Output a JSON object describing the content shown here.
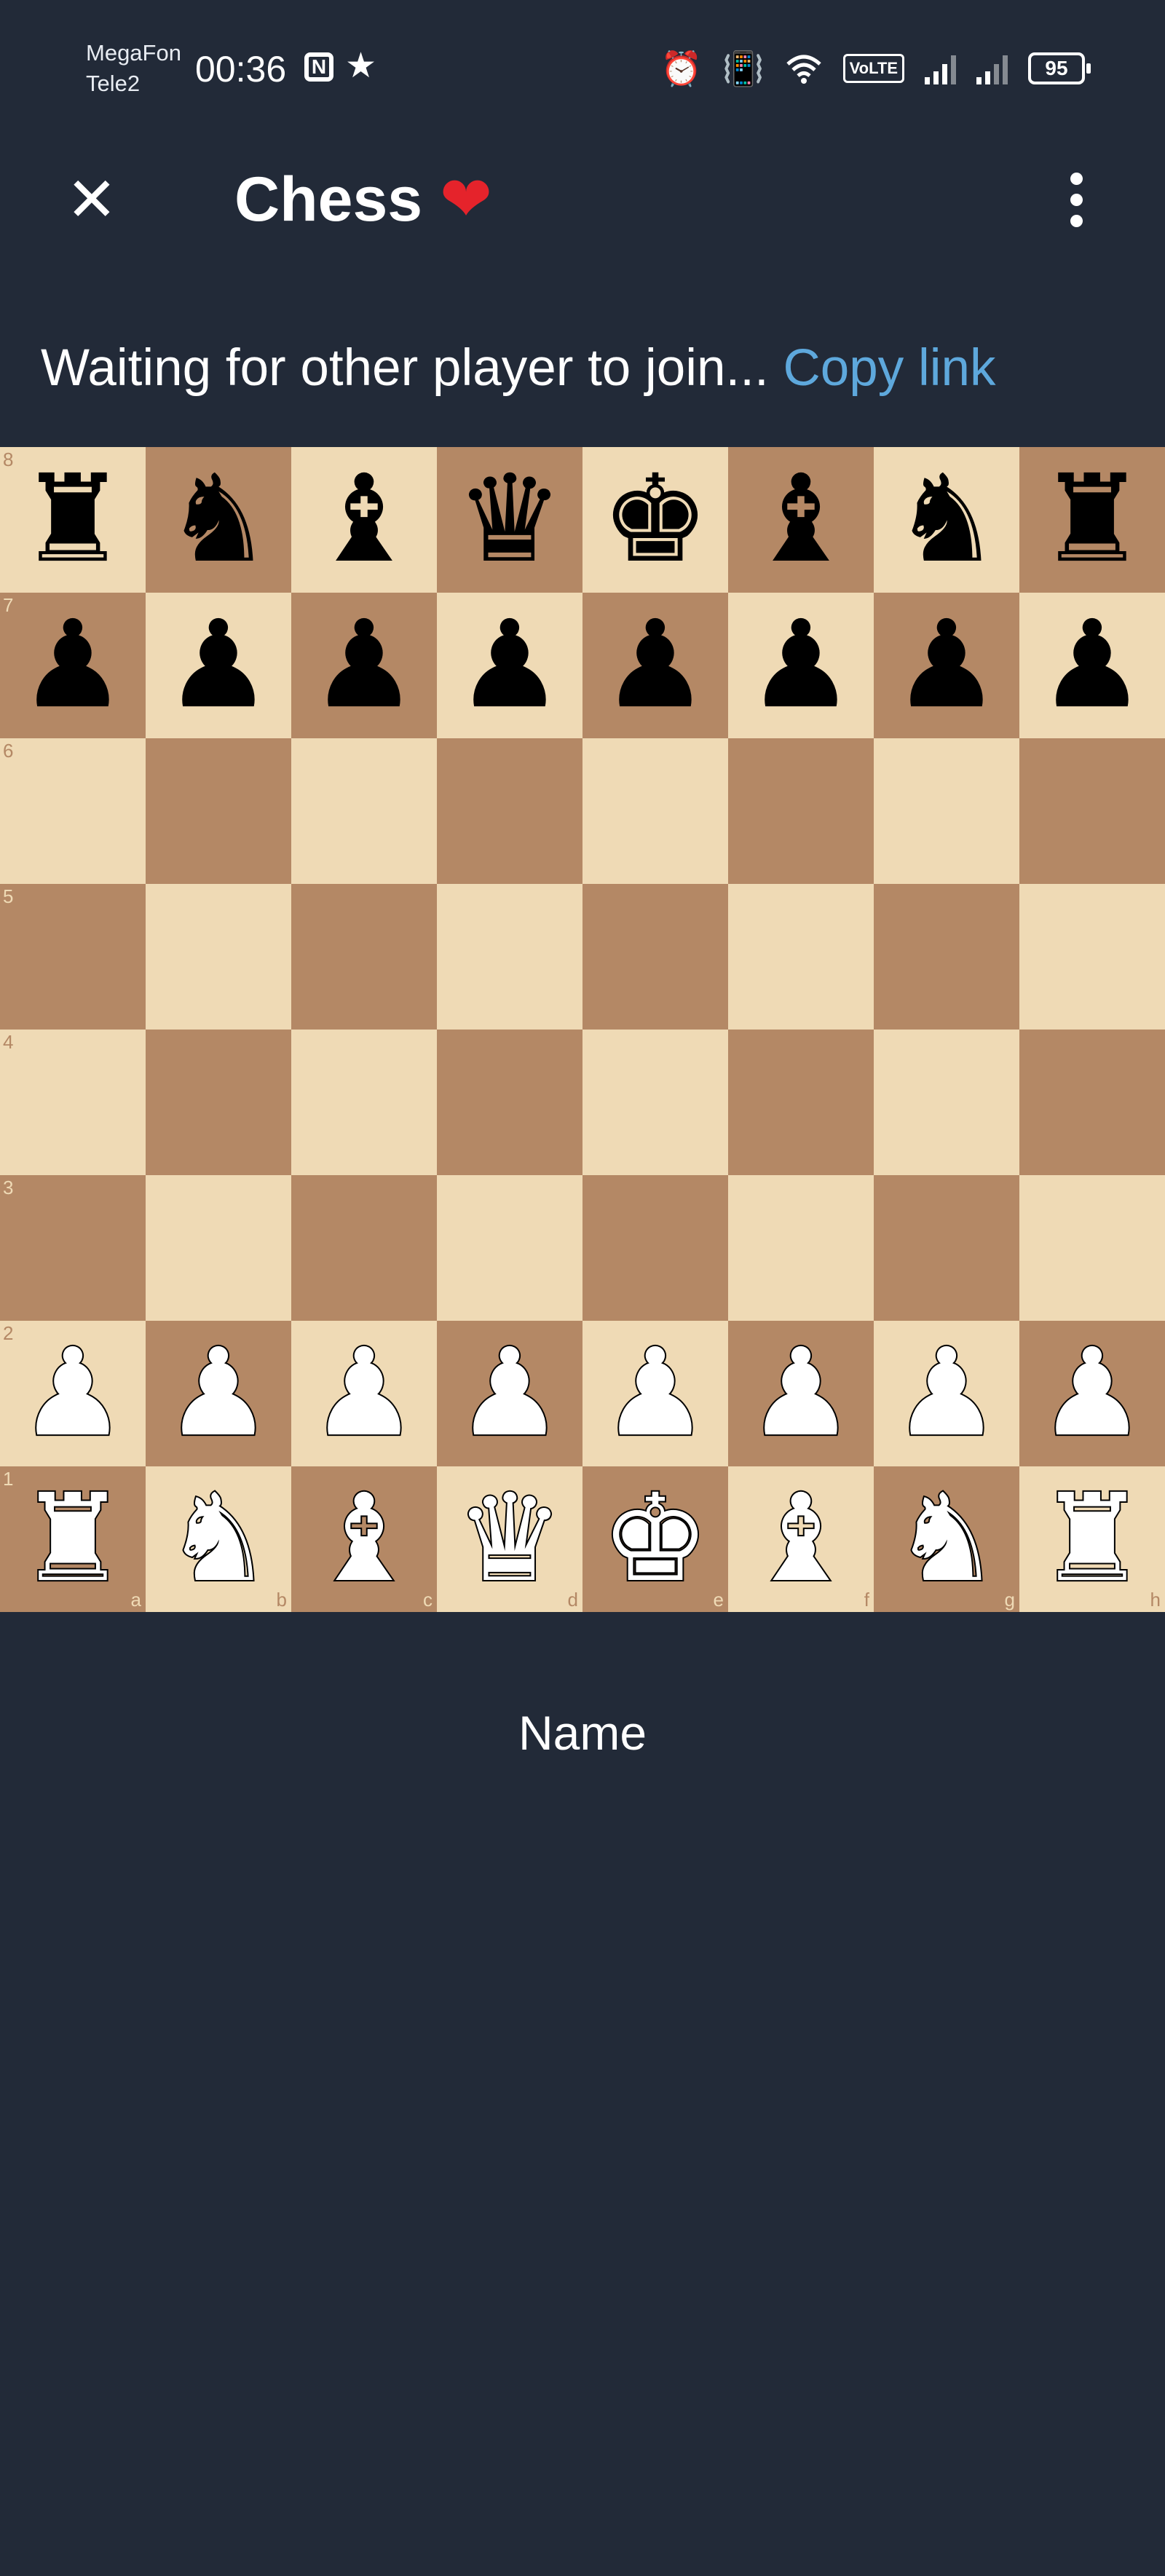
{
  "status_bar": {
    "carrier_1": "MegaFon",
    "carrier_2": "Tele2",
    "time": "00:36",
    "nfc_label": "N",
    "star": "★",
    "volte": "VoLTE",
    "battery": "95",
    "icons": [
      "alarm-icon",
      "vibrate-icon",
      "wifi-icon",
      "signal-icon",
      "signal-icon",
      "battery-icon"
    ]
  },
  "app_bar": {
    "close_glyph": "✕",
    "title": "Chess",
    "title_emoji": "❤",
    "accent_heart": "#e5232b"
  },
  "status_line": {
    "text": "Waiting for other player to join...",
    "link": "Copy link",
    "link_color": "#5ea8dc"
  },
  "board": {
    "light_color": "#efdab5",
    "dark_color": "#b48865",
    "ranks": [
      "8",
      "7",
      "6",
      "5",
      "4",
      "3",
      "2",
      "1"
    ],
    "files": [
      "a",
      "b",
      "c",
      "d",
      "e",
      "f",
      "g",
      "h"
    ],
    "rows": [
      [
        "br",
        "bn",
        "bb",
        "bq",
        "bk",
        "bb",
        "bn",
        "br"
      ],
      [
        "bp",
        "bp",
        "bp",
        "bp",
        "bp",
        "bp",
        "bp",
        "bp"
      ],
      [
        "",
        "",
        "",
        "",
        "",
        "",
        "",
        ""
      ],
      [
        "",
        "",
        "",
        "",
        "",
        "",
        "",
        ""
      ],
      [
        "",
        "",
        "",
        "",
        "",
        "",
        "",
        ""
      ],
      [
        "",
        "",
        "",
        "",
        "",
        "",
        "",
        ""
      ],
      [
        "wp",
        "wp",
        "wp",
        "wp",
        "wp",
        "wp",
        "wp",
        "wp"
      ],
      [
        "wr",
        "wn",
        "wb",
        "wq",
        "wk",
        "wb",
        "wn",
        "wr"
      ]
    ]
  },
  "player": {
    "name": "Name"
  }
}
